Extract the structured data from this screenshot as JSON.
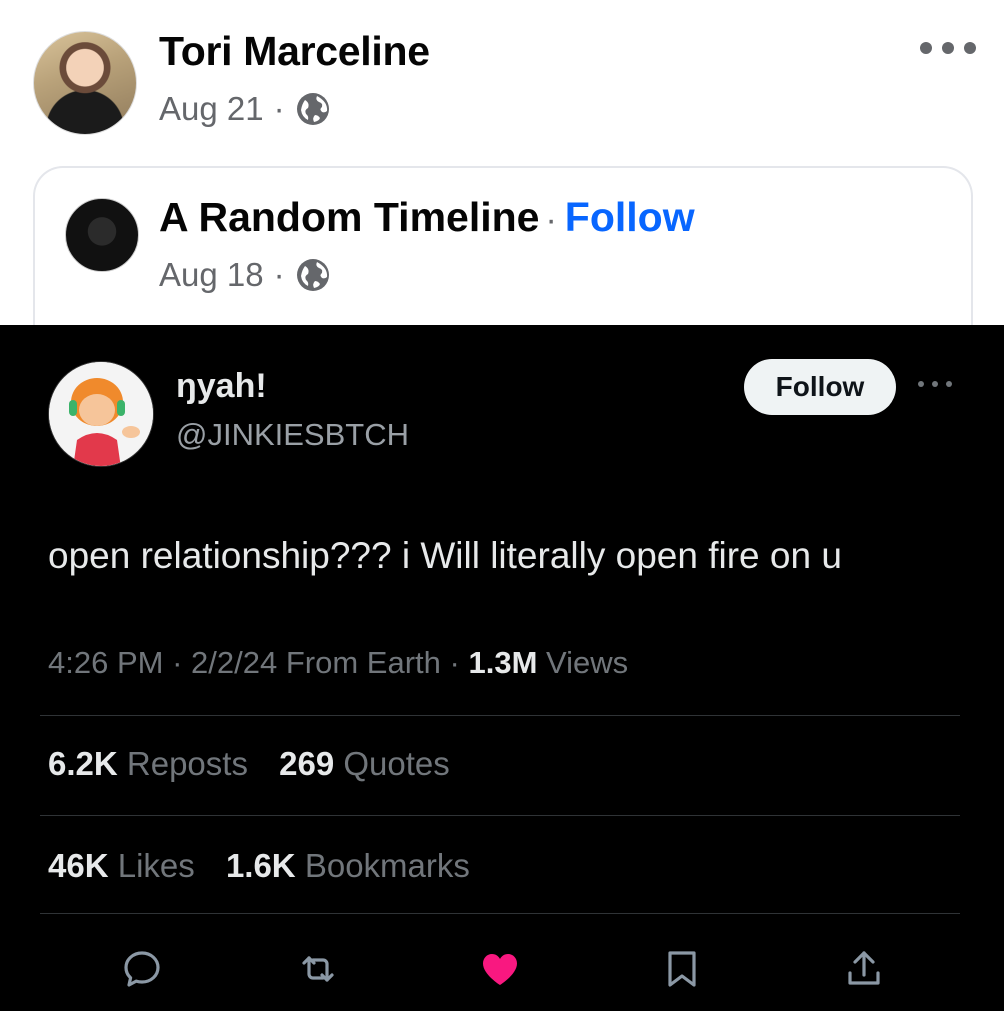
{
  "post": {
    "author": "Tori Marceline",
    "date": "Aug 21",
    "separator": "·",
    "audience_icon": "globe-icon",
    "more_icon": "more-dots-icon"
  },
  "shared": {
    "page_name": "A Random Timeline",
    "separator": "·",
    "follow_label": "Follow",
    "date": "Aug 18",
    "audience_icon": "globe-icon"
  },
  "tweet": {
    "display_name": "ŋyah!",
    "handle": "@JINKIESBTCH",
    "follow_label": "Follow",
    "text": "open relationship??? i Will literally open fire on u",
    "time": "4:26 PM",
    "date": "2/2/24",
    "source": "From Earth",
    "views_count": "1.3M",
    "views_label": "Views",
    "sep": "·",
    "reposts_count": "6.2K",
    "reposts_label": "Reposts",
    "quotes_count": "269",
    "quotes_label": "Quotes",
    "likes_count": "46K",
    "likes_label": "Likes",
    "bookmarks_count": "1.6K",
    "bookmarks_label": "Bookmarks",
    "liked_color": "#f91880",
    "actions": [
      "reply-icon",
      "repost-icon",
      "like-icon",
      "bookmark-icon",
      "share-icon"
    ]
  }
}
